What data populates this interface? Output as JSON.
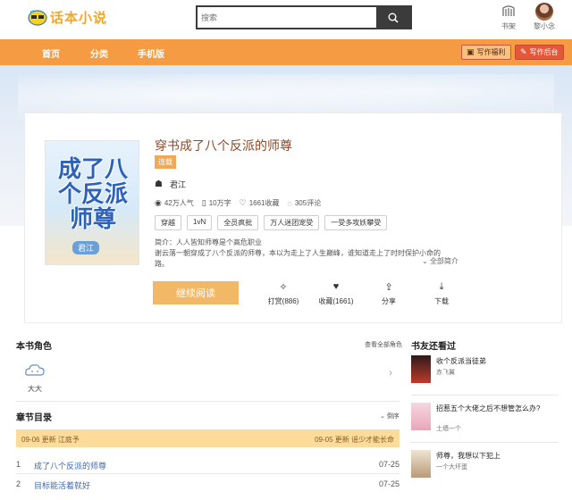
{
  "header": {
    "logo_text": "话本小说",
    "search_placeholder": "搜索",
    "shelf_label": "书架",
    "user_name": "黎小念"
  },
  "nav": {
    "items": [
      "首页",
      "分类",
      "手机版"
    ],
    "welfare_label": "写作福利",
    "backend_label": "写作后台"
  },
  "book": {
    "cover_title": "成了八个反派师尊",
    "cover_author": "君江",
    "title": "穿书成了八个反派的师尊",
    "status": "连载",
    "author": "君江",
    "stats": {
      "popularity": "42万人气",
      "words": "10万字",
      "favorites": "1661收藏",
      "comments": "305评论"
    },
    "tags": [
      "穿越",
      "1vN",
      "全员疯批",
      "万人迷团宠受",
      "一受多攻妖攀受"
    ],
    "intro_line1": "简介：人人皆知师尊是个高危职业",
    "intro_line2": "谢云落一朝穿成了八个反派的师尊，本以为走上了人生巅峰，谁知道走上了时时保护小命的路。",
    "more_label": "全部简介",
    "read_label": "继续阅读",
    "actions": {
      "reward": "打赏(886)",
      "favorite": "收藏(1661)",
      "share": "分享",
      "download": "下载"
    }
  },
  "characters": {
    "title": "本书角色",
    "view_all": "查看全部角色",
    "items": [
      {
        "name": "大大"
      }
    ]
  },
  "chapters": {
    "title": "章节目录",
    "sort_label": "倒序",
    "latest_left": "09-06 更新  江庭予",
    "latest_right": "09-05 更新  谣少才能长命",
    "items": [
      {
        "num": "1",
        "name": "成了八个反派的师尊",
        "date": "07-25"
      },
      {
        "num": "2",
        "name": "目标能活着就好",
        "date": "07-25"
      }
    ]
  },
  "also_read": {
    "title": "书友还看过",
    "items": [
      {
        "title": "收个反派当徒弟",
        "author": "赤飞翼",
        "color": "#c0392b"
      },
      {
        "title": "招惹五个大佬之后不想管怎么办?",
        "author": "土墙一个",
        "color": "#e9a6b9"
      },
      {
        "title": "师尊，我想以下犯上",
        "author": "一个大坏蛋",
        "color": "#d9c6a8"
      }
    ]
  },
  "colors": {
    "nav": "#f49b43",
    "accent_title": "#8b4a2a",
    "read_button": "#f2b865",
    "latest_bar": "#fbdc9a",
    "chapter_link": "#3d6bb3"
  }
}
